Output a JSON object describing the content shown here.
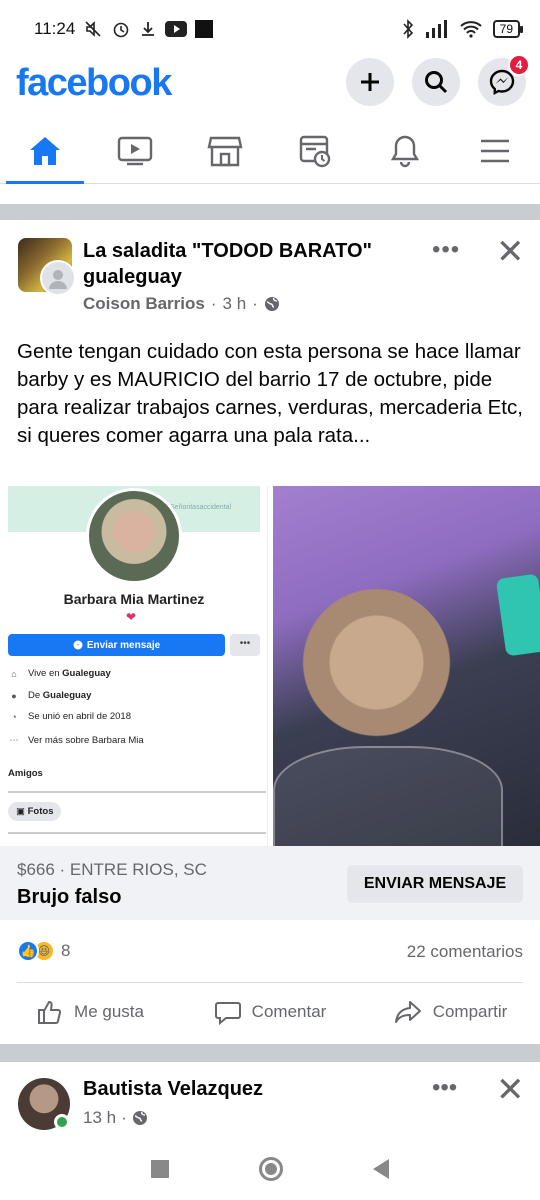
{
  "status_bar": {
    "time": "11:24",
    "battery": "79"
  },
  "header": {
    "logo": "facebook",
    "messenger_badge": "4"
  },
  "tabs": [
    {
      "name": "home",
      "active": true
    },
    {
      "name": "watch"
    },
    {
      "name": "marketplace"
    },
    {
      "name": "memories"
    },
    {
      "name": "notifications"
    },
    {
      "name": "menu"
    }
  ],
  "post": {
    "group_name": "La saladita \"TODOD BARATO\" gualeguay",
    "author": "Coison Barrios",
    "time": "3 h",
    "text": "Gente tengan cuidado con esta persona se hace llamar barby y es MAURICIO del barrio 17 de octubre, pide para realizar trabajos carnes, verduras, mercaderia Etc, si queres comer agarra una pala rata...",
    "screenshot": {
      "cover_text": "Señoritasaccidental",
      "profile_name": "Barbara Mia Martinez",
      "message_button": "Enviar mensaje",
      "lives_in_prefix": "Vive en",
      "lives_in_place": "Gualeguay",
      "from_prefix": "De",
      "from_place": "Gualeguay",
      "joined": "Se unió en abril de 2018",
      "see_more": "Ver más sobre Barbara Mia",
      "friends_label": "Amigos",
      "photos_label": "Fotos"
    },
    "listing": {
      "price_location": "$666 · ENTRE RIOS, SC",
      "item_title": "Brujo falso",
      "send_button": "ENVIAR MENSAJE"
    },
    "reactions_count": "8",
    "comments": "22 comentarios",
    "actions": {
      "like": "Me gusta",
      "comment": "Comentar",
      "share": "Compartir"
    }
  },
  "next_post": {
    "author": "Bautista Velazquez",
    "time": "13 h"
  }
}
